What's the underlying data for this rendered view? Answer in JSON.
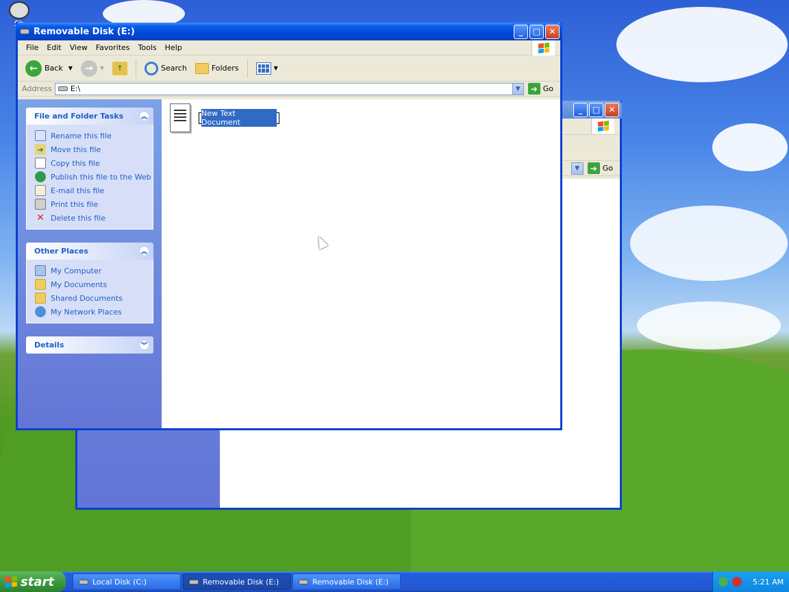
{
  "desktop": {
    "icon_label": "Sh"
  },
  "back_window": {
    "go_label": "Go"
  },
  "window": {
    "title": "Removable Disk (E:)",
    "menu": [
      "File",
      "Edit",
      "View",
      "Favorites",
      "Tools",
      "Help"
    ],
    "toolbar": {
      "back_label": "Back",
      "search_label": "Search",
      "folders_label": "Folders"
    },
    "address": {
      "label": "Address",
      "value": "E:\\",
      "go_label": "Go"
    },
    "panels": {
      "file_tasks": {
        "title": "File and Folder Tasks",
        "items": [
          {
            "label": "Rename this file",
            "icon": "rename-icon"
          },
          {
            "label": "Move this file",
            "icon": "move-icon"
          },
          {
            "label": "Copy this file",
            "icon": "copy-icon"
          },
          {
            "label": "Publish this file to the Web",
            "icon": "globe-icon"
          },
          {
            "label": "E-mail this file",
            "icon": "email-icon"
          },
          {
            "label": "Print this file",
            "icon": "printer-icon"
          },
          {
            "label": "Delete this file",
            "icon": "delete-icon"
          }
        ]
      },
      "other_places": {
        "title": "Other Places",
        "items": [
          {
            "label": "My Computer",
            "icon": "computer-icon"
          },
          {
            "label": "My Documents",
            "icon": "documents-folder-icon"
          },
          {
            "label": "Shared Documents",
            "icon": "folder-icon"
          },
          {
            "label": "My Network Places",
            "icon": "network-icon"
          }
        ]
      },
      "details": {
        "title": "Details"
      }
    },
    "files": [
      {
        "name": "New Text Document",
        "icon": "notepad-file-icon",
        "editing": true
      }
    ]
  },
  "taskbar": {
    "start_label": "start",
    "items": [
      {
        "label": "Local Disk (C:)",
        "active": false
      },
      {
        "label": "Removable Disk (E:)",
        "active": true
      },
      {
        "label": "Removable Disk (E:)",
        "active": false
      }
    ],
    "clock": "5:21 AM"
  },
  "colors": {
    "title_blue": "#0048d8",
    "task_link": "#215dc6",
    "sidepane": "#6375d6"
  }
}
